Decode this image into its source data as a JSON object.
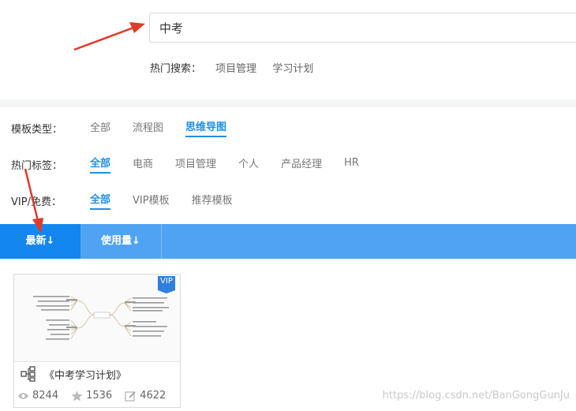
{
  "search": {
    "value": "中考"
  },
  "hot_search": {
    "label": "热门搜索：",
    "items": [
      "项目管理",
      "学习计划"
    ]
  },
  "filters": {
    "template_type": {
      "label": "模板类型：",
      "options": [
        "全部",
        "流程图",
        "思维导图"
      ]
    },
    "hot_tags": {
      "label": "热门标签：",
      "options": [
        "全部",
        "电商",
        "项目管理",
        "个人",
        "产品经理",
        "HR"
      ]
    },
    "vip_free": {
      "label": "VIP/免费：",
      "options": [
        "全部",
        "VIP模板",
        "推荐模板"
      ]
    }
  },
  "sort": {
    "newest": "最新↓",
    "usage": "使用量↓"
  },
  "cards": [
    {
      "badge": "VIP",
      "title": "《中考学习计划》",
      "views": "8244",
      "likes": "1536",
      "edits": "4622"
    }
  ],
  "watermark": "https://blog.csdn.net/BanGongGunJu",
  "colors": {
    "accent": "#1e8fe8",
    "sortbar": "#50a3f3",
    "sort_active": "#1386f0",
    "arrow": "#e03a2a"
  }
}
